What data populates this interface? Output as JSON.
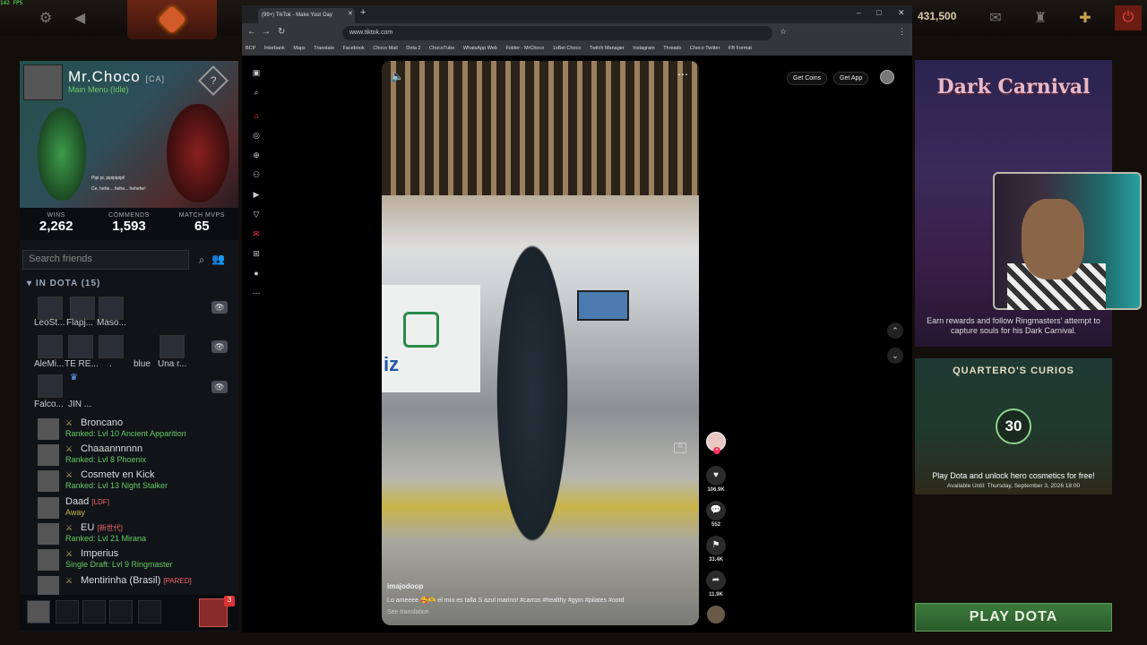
{
  "overlay": {
    "fps": "142 FPS"
  },
  "dota": {
    "gold": "431,500",
    "profile": {
      "name": "Mr.Choco",
      "tag": "[CA]",
      "status": "Main Menu (Idle)",
      "chat1": "Pipi pi, pipipipipi!",
      "chat2": "Ce, hehe... hehe... hehehe!"
    },
    "stats": [
      {
        "label": "WINS",
        "value": "2,262"
      },
      {
        "label": "COMMENDS",
        "value": "1,593"
      },
      {
        "label": "MATCH MVPS",
        "value": "65"
      }
    ],
    "search_placeholder": "Search friends",
    "group": "IN DOTA (15)",
    "tile_rows": [
      [
        "LeoSt...",
        "Flapj...",
        "Maso..."
      ],
      [
        "AleMi...",
        "TE RE...",
        ".",
        "blue",
        "Una r..."
      ],
      [
        "Falco...",
        "JIN ..."
      ]
    ],
    "friends": [
      {
        "name": "Broncano",
        "tag": "",
        "status": "Ranked: Lvl 10 Ancient Apparition"
      },
      {
        "name": "Chaaannnnnn",
        "tag": "",
        "status": "Ranked: Lvl 8 Phoenix"
      },
      {
        "name": "Cosmetv en Kick",
        "tag": "",
        "status": "Ranked: Lvl 13 Night Stalker"
      },
      {
        "name": "Daad",
        "tag": "[LDF]",
        "status": "Away"
      },
      {
        "name": "EU",
        "tag": "[新世代]",
        "status": "Ranked: Lvl 21 Mirana"
      },
      {
        "name": "Imperius",
        "tag": "",
        "status": "Single Draft: Lvl 9 Ringmaster"
      },
      {
        "name": "Mentirinha (Brasil)",
        "tag": "[PARED]",
        "status": ""
      }
    ],
    "notif_count": "3",
    "carnival": {
      "title": "Dark Carnival",
      "desc": "Earn rewards and follow Ringmasters' attempt to capture souls for his Dark Carnival."
    },
    "curios": {
      "title": "QUARTERO'S CURIOS",
      "number": "30",
      "desc": "Play Dota and unlock hero cosmetics for free!",
      "date": "Available Until:  Thursday, September 3, 2026 18:00"
    },
    "play": "PLAY DOTA"
  },
  "browser": {
    "tab": "(99+) TikTok - Make Your Day",
    "url": "www.tiktok.com",
    "bookmarks": [
      "BCP",
      "Interbank",
      "Maps",
      "Translate",
      "Facebook",
      "Choco Mail",
      "Dota 2",
      "ChocoTube",
      "WhatsApp Web",
      "Folder - MrChoco",
      "1xBet Choco",
      "Twitch Manager",
      "Instagram",
      "Threads",
      "Choco Twitter",
      "FB Format"
    ]
  },
  "tiktok": {
    "get_coins": "Get Coins",
    "get_app": "Get App",
    "author": "imajodoop",
    "caption": "Lo ameeee 🥰🫶 el mío es talla S azul marino! #carros #healthy #gym #pilates #ootd",
    "see_translation": "See translation",
    "likes": "106.9K",
    "comments": "552",
    "saves": "33.4K",
    "shares": "11.9K"
  }
}
